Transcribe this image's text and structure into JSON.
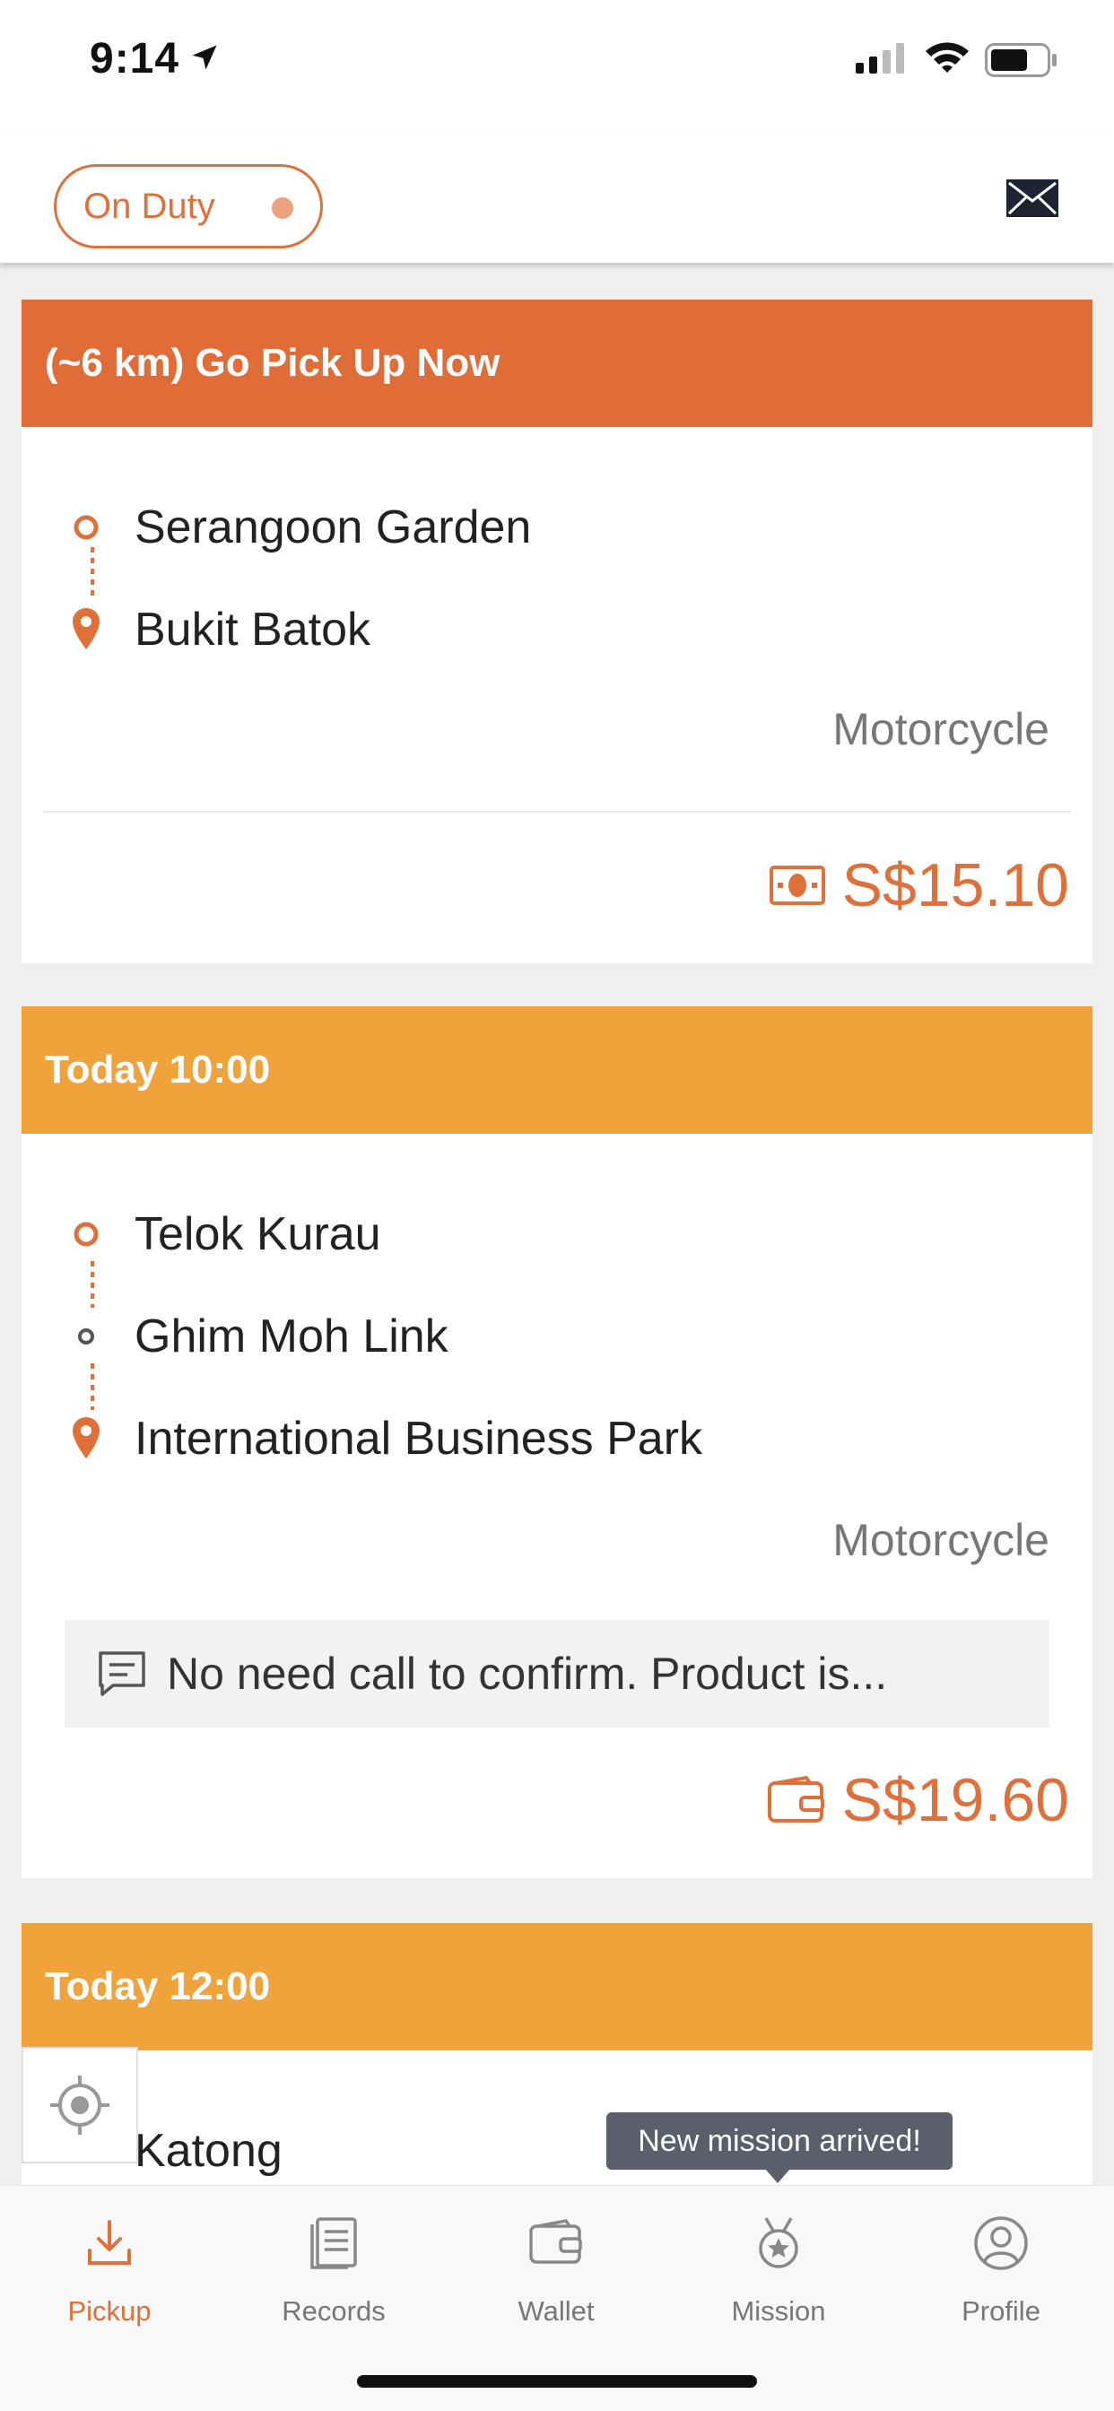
{
  "status_bar": {
    "time": "9:14"
  },
  "header": {
    "duty_label": "On Duty"
  },
  "colors": {
    "accent": "#e0703a",
    "urgent_header": "#e06c38",
    "scheduled_header": "#f0a33a"
  },
  "orders": [
    {
      "header": "(~6 km) Go Pick Up Now",
      "stops": [
        "Serangoon Garden",
        "Bukit Batok"
      ],
      "vehicle": "Motorcycle",
      "payment_icon": "cash-icon",
      "price": "S$15.10"
    },
    {
      "header": "Today 10:00",
      "stops": [
        "Telok Kurau",
        "Ghim Moh Link",
        "International Business Park"
      ],
      "vehicle": "Motorcycle",
      "note": "No need call to confirm. Product is...",
      "payment_icon": "wallet-icon",
      "price": "S$19.60"
    },
    {
      "header": "Today 12:00",
      "stops": [
        "Katong"
      ]
    }
  ],
  "tooltip": "New mission arrived!",
  "tabs": [
    {
      "label": "Pickup",
      "icon": "download-icon",
      "active": true
    },
    {
      "label": "Records",
      "icon": "records-icon",
      "active": false
    },
    {
      "label": "Wallet",
      "icon": "wallet-icon",
      "active": false
    },
    {
      "label": "Mission",
      "icon": "medal-icon",
      "active": false
    },
    {
      "label": "Profile",
      "icon": "profile-icon",
      "active": false
    }
  ]
}
